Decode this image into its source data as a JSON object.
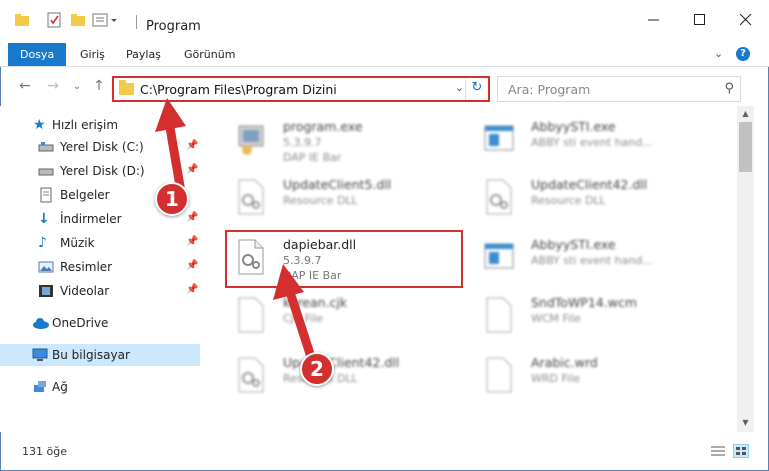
{
  "window": {
    "title": "Program"
  },
  "ribbon": {
    "tabs": [
      "Dosya",
      "Giriş",
      "Paylaş",
      "Görünüm"
    ]
  },
  "address": {
    "path": "C:\\Program Files\\Program Dizini"
  },
  "search": {
    "placeholder": "Ara: Program"
  },
  "sidebar": {
    "items": [
      {
        "label": "Hızlı erişim"
      },
      {
        "label": "Yerel Disk (C:)"
      },
      {
        "label": "Yerel Disk (D:)"
      },
      {
        "label": "Belgeler"
      },
      {
        "label": "İndirmeler"
      },
      {
        "label": "Müzik"
      },
      {
        "label": "Resimler"
      },
      {
        "label": "Videolar"
      },
      {
        "label": "OneDrive"
      },
      {
        "label": "Bu bilgisayar"
      },
      {
        "label": "Ağ"
      }
    ]
  },
  "files": [
    {
      "name": "program.exe",
      "line2": "5.3.9.7",
      "line3": "DAP IE Bar"
    },
    {
      "name": "AbbyySTI.exe",
      "line2": "ABBY sti event hand...",
      "line3": ""
    },
    {
      "name": "UpdateClient5.dll",
      "line2": "Resource DLL",
      "line3": ""
    },
    {
      "name": "UpdateClient42.dll",
      "line2": "Resource DLL",
      "line3": ""
    },
    {
      "name": "dapiebar.dll",
      "line2": "5.3.9.7",
      "line3": "DAP IE Bar"
    },
    {
      "name": "AbbyySTI.exe",
      "line2": "ABBY sti event hand...",
      "line3": ""
    },
    {
      "name": "korean.cjk",
      "line2": "CJK File",
      "line3": ""
    },
    {
      "name": "SndToWP14.wcm",
      "line2": "WCM File",
      "line3": ""
    },
    {
      "name": "UpdateClient42.dll",
      "line2": "Resource DLL",
      "line3": ""
    },
    {
      "name": "Arabic.wrd",
      "line2": "WRD File",
      "line3": ""
    }
  ],
  "status": {
    "count": "131 öğe"
  },
  "callouts": [
    "1",
    "2"
  ],
  "colors": {
    "accent": "#1979ca",
    "highlight": "#d32f2f",
    "selected": "#cce8ff"
  }
}
